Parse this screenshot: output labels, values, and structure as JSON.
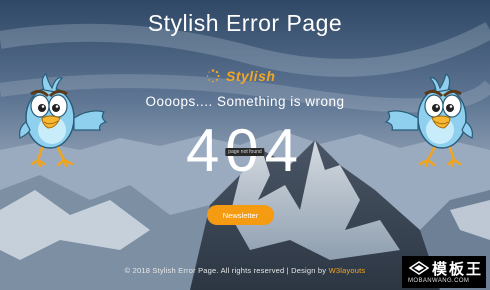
{
  "page": {
    "title": "Stylish Error Page",
    "brand": "Stylish",
    "subtitle": "Oooops.... Something is wrong",
    "error_code": "404",
    "error_note": "page not found",
    "button_label": "Newsletter",
    "footer_text": "© 2018 Stylish Error Page. All rights reserved | Design by",
    "footer_link": "W3layouts"
  },
  "watermark": {
    "main": "模板王",
    "sub": "MOBANWANG.COM"
  },
  "colors": {
    "accent": "#f59b12",
    "brand": "#f5a623",
    "text": "#ffffff"
  }
}
